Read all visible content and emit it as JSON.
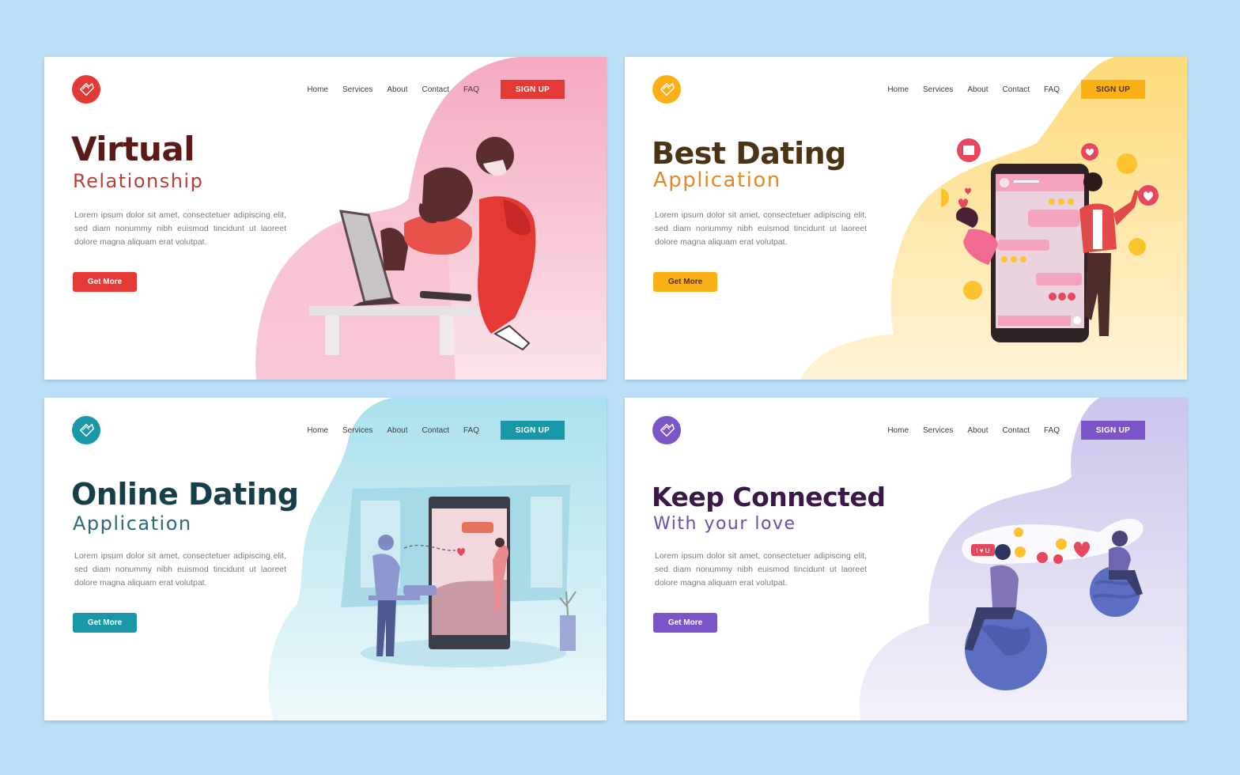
{
  "background_color": "#bcdff8",
  "nav_items": [
    "Home",
    "Services",
    "About",
    "Contact",
    "FAQ"
  ],
  "cards": [
    {
      "theme": "red",
      "logo_icon": "heart-logo-icon",
      "accent": "#e53935",
      "title_color": "#5a1a1a",
      "subtitle_color": "#b5413b",
      "blob_color": "#f5b8c9",
      "nav": [
        "Home",
        "Services",
        "About",
        "Contact",
        "FAQ"
      ],
      "signup_label": "SIGN UP",
      "signup_text_color": "#ffffff",
      "title": "Virtual",
      "subtitle": "Relationship",
      "body": "Lorem ipsum dolor sit amet, consectetuer adipiscing elit, sed diam nonummy nibh euismod tincidunt ut laoreet dolore magna aliquam erat volutpat.",
      "cta_label": "Get More",
      "cta_text_color": "#ffffff",
      "illustration": "couple hugging through computer monitor"
    },
    {
      "theme": "yellow",
      "logo_icon": "heart-logo-icon",
      "accent": "#fbb018",
      "title_color": "#4a3415",
      "subtitle_color": "#e08a2c",
      "blob_color": "#fde39a",
      "nav": [
        "Home",
        "Services",
        "About",
        "Contact",
        "FAQ"
      ],
      "signup_label": "SIGN UP",
      "signup_text_color": "#4a3415",
      "title": "Best Dating",
      "subtitle": "Application",
      "body": "Lorem ipsum dolor sit amet, consectetuer adipiscing elit, sed diam nonummy nibh euismod tincidunt ut laoreet dolore magna aliquam erat volutpat.",
      "cta_label": "Get More",
      "cta_text_color": "#4a3415",
      "illustration": "smartphone chat with emojis and hearts, man and woman"
    },
    {
      "theme": "teal",
      "logo_icon": "heart-logo-icon",
      "accent": "#1a97a6",
      "title_color": "#163f4a",
      "subtitle_color": "#2a6a74",
      "blob_color": "#bfe9f2",
      "nav": [
        "Home",
        "Services",
        "About",
        "Contact",
        "FAQ"
      ],
      "signup_label": "SIGN UP",
      "signup_text_color": "#ffffff",
      "title": "Online Dating",
      "subtitle": "Application",
      "body": "Lorem ipsum dolor sit amet, consectetuer adipiscing elit, sed diam nonummy nibh euismod tincidunt ut laoreet dolore magna aliquam erat volutpat.",
      "cta_label": "Get More",
      "cta_text_color": "#ffffff",
      "illustration": "man waving at woman on large phone screen"
    },
    {
      "theme": "purple",
      "logo_icon": "heart-logo-icon",
      "accent": "#7b55c7",
      "title_color": "#3a1848",
      "subtitle_color": "#6a4ea8",
      "blob_color": "#d7d3ef",
      "nav": [
        "Home",
        "Services",
        "About",
        "Contact",
        "FAQ"
      ],
      "signup_label": "SIGN UP",
      "signup_text_color": "#ffffff",
      "title": "Keep Connected",
      "subtitle": "With your love",
      "body": "Lorem ipsum dolor sit amet, consectetuer adipiscing elit, sed diam nonummy nibh euismod tincidunt ut laoreet dolore magna aliquam erat volutpat.",
      "cta_label": "Get More",
      "cta_text_color": "#ffffff",
      "illustration": "two people on planets exchanging hearts and emojis",
      "bubble_text": "I ♥ U"
    }
  ]
}
